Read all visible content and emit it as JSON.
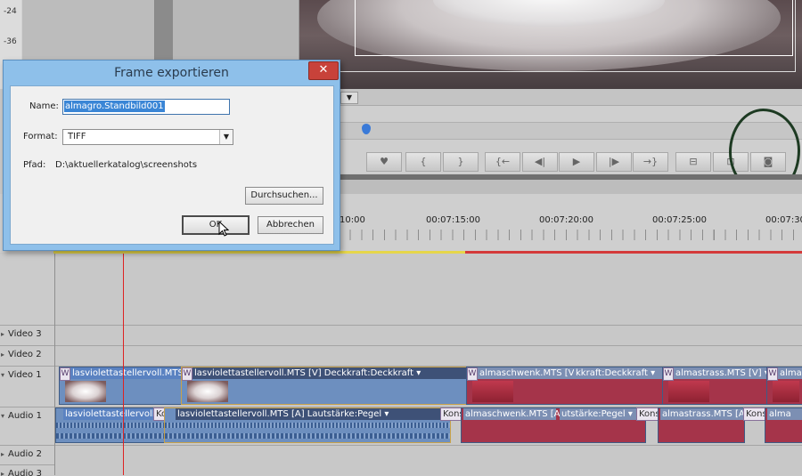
{
  "meter": {
    "scale": [
      "-24",
      "-36"
    ]
  },
  "controls": {
    "dropdown_arrow": "▼",
    "buttons": [
      {
        "icon": "marker-icon",
        "glyph": "♥"
      },
      {
        "icon": "set-in-icon",
        "glyph": "{"
      },
      {
        "icon": "set-out-icon",
        "glyph": "}"
      },
      {
        "icon": "goto-in-icon",
        "glyph": "{←"
      },
      {
        "icon": "step-back-icon",
        "glyph": "◀|"
      },
      {
        "icon": "play-icon",
        "glyph": "▶"
      },
      {
        "icon": "step-forward-icon",
        "glyph": "|▶"
      },
      {
        "icon": "goto-out-icon",
        "glyph": "→}"
      },
      {
        "icon": "insert-icon",
        "glyph": "⊟"
      },
      {
        "icon": "overlay-icon",
        "glyph": "⊡"
      },
      {
        "icon": "camera-icon",
        "glyph": "◙"
      }
    ]
  },
  "ruler": {
    "timecodes": [
      "10:00",
      "00:07:15:00",
      "00:07:20:00",
      "00:07:25:00",
      "00:07:30"
    ]
  },
  "tracks": {
    "video3": "Video 3",
    "video2": "Video 2",
    "video1": "Video 1",
    "audio1": "Audio 1",
    "audio2": "Audio 2",
    "audio3": "Audio 3"
  },
  "clips": {
    "v1": [
      {
        "title": "lasviolettastellervoll.MTS",
        "prefix": "W"
      },
      {
        "title": "lasviolettastellervoll.MTS [V]  Deckkraft:Deckkraft ▾",
        "prefix": "W"
      },
      {
        "title": "almaschwenk.MTS [V]",
        "prefix": "W"
      },
      {
        "title": "kkraft:Deckkraft ▾",
        "prefix": ""
      },
      {
        "title": "almastrass.MTS [V] ▾",
        "prefix": "W"
      },
      {
        "title": "alma",
        "prefix": "W"
      }
    ],
    "a1": [
      {
        "title": "lasviolettastellervoll"
      },
      {
        "title": "Kons",
        "box": true
      },
      {
        "title": "lasviolettastellervoll.MTS [A]  Lautstärke:Pegel ▾"
      },
      {
        "title": "Kons",
        "box": true
      },
      {
        "title": "almaschwenk.MTS [A]"
      },
      {
        "title": "utstärke:Pegel ▾"
      },
      {
        "title": "Kons",
        "box": true
      },
      {
        "title": "almastrass.MTS [A]"
      },
      {
        "title": "Kons",
        "box": true
      },
      {
        "title": "alma"
      }
    ]
  },
  "dialog": {
    "title": "Frame exportieren",
    "close": "✕",
    "name_label": "Name:",
    "name_value": "almagro.Standbild001",
    "format_label": "Format:",
    "format_value": "TIFF",
    "path_label": "Pfad:",
    "path_value": "D:\\aktuellerkatalog\\screenshots",
    "browse": "Durchsuchen...",
    "ok": "OK",
    "cancel": "Abbrechen"
  },
  "colors": {
    "accent": "#3a86d6",
    "playhead": "#d22222",
    "annotation": "#1d3a22"
  }
}
